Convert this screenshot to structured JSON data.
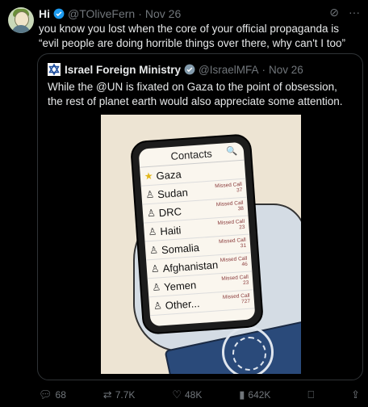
{
  "tweet": {
    "name": "Hi",
    "handle": "@TOliveFern",
    "date": "Nov 26",
    "text": "you know you lost when the core of your official propaganda is “evil people are doing horrible things over there, why can't I too”"
  },
  "quote": {
    "name": "Israel Foreign Ministry",
    "handle": "@IsraelMFA",
    "date": "Nov 26",
    "text": "While the @UN is fixated on Gaza to the point of obsession, the rest of planet earth would also appreciate some attention."
  },
  "phone": {
    "header": "Contacts",
    "contacts": [
      {
        "name": "Gaza",
        "missed": "",
        "count": ""
      },
      {
        "name": "Sudan",
        "missed": "Missed Call",
        "count": "37"
      },
      {
        "name": "DRC",
        "missed": "Missed Call",
        "count": "38"
      },
      {
        "name": "Haiti",
        "missed": "Missed Call",
        "count": "23"
      },
      {
        "name": "Somalia",
        "missed": "Missed Call",
        "count": "31"
      },
      {
        "name": "Afghanistan",
        "missed": "Missed Call",
        "count": "46"
      },
      {
        "name": "Yemen",
        "missed": "Missed Call",
        "count": "23"
      },
      {
        "name": "Other...",
        "missed": "Missed Call",
        "count": "727"
      }
    ]
  },
  "actions": {
    "replies": "68",
    "reposts": "7.7K",
    "likes": "48K",
    "views": "642K"
  },
  "colors": {
    "verified": "#1d9bf0",
    "verified_gold": "#e2b719",
    "muted": "#71767b"
  }
}
